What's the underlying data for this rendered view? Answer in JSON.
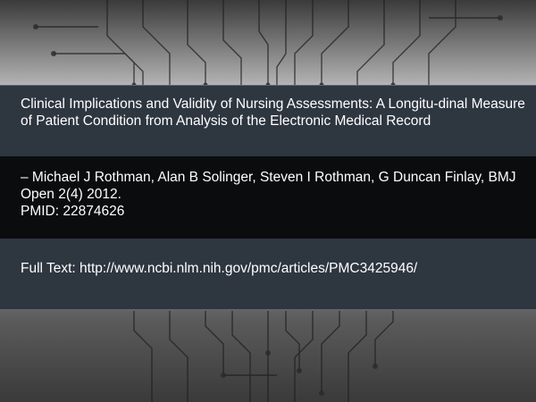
{
  "slide": {
    "title": "Clinical Implications and Validity of Nursing Assessments: A Longitu-dinal Measure of Patient Condition from Analysis of the Electronic Medical Record",
    "authors": "– Michael J Rothman, Alan B Solinger, Steven I Rothman, G Duncan Finlay, BMJ Open 2(4) 2012.",
    "pmid": "PMID: 22874626",
    "full_text": "Full Text: http://www.ncbi.nlm.nih.gov/pmc/articles/PMC3425946/"
  },
  "colors": {
    "band_dark_blue": "#2e3640",
    "band_black": "#0b0c0d",
    "text": "#ffffff"
  },
  "icons": [
    "circuit-pattern"
  ]
}
